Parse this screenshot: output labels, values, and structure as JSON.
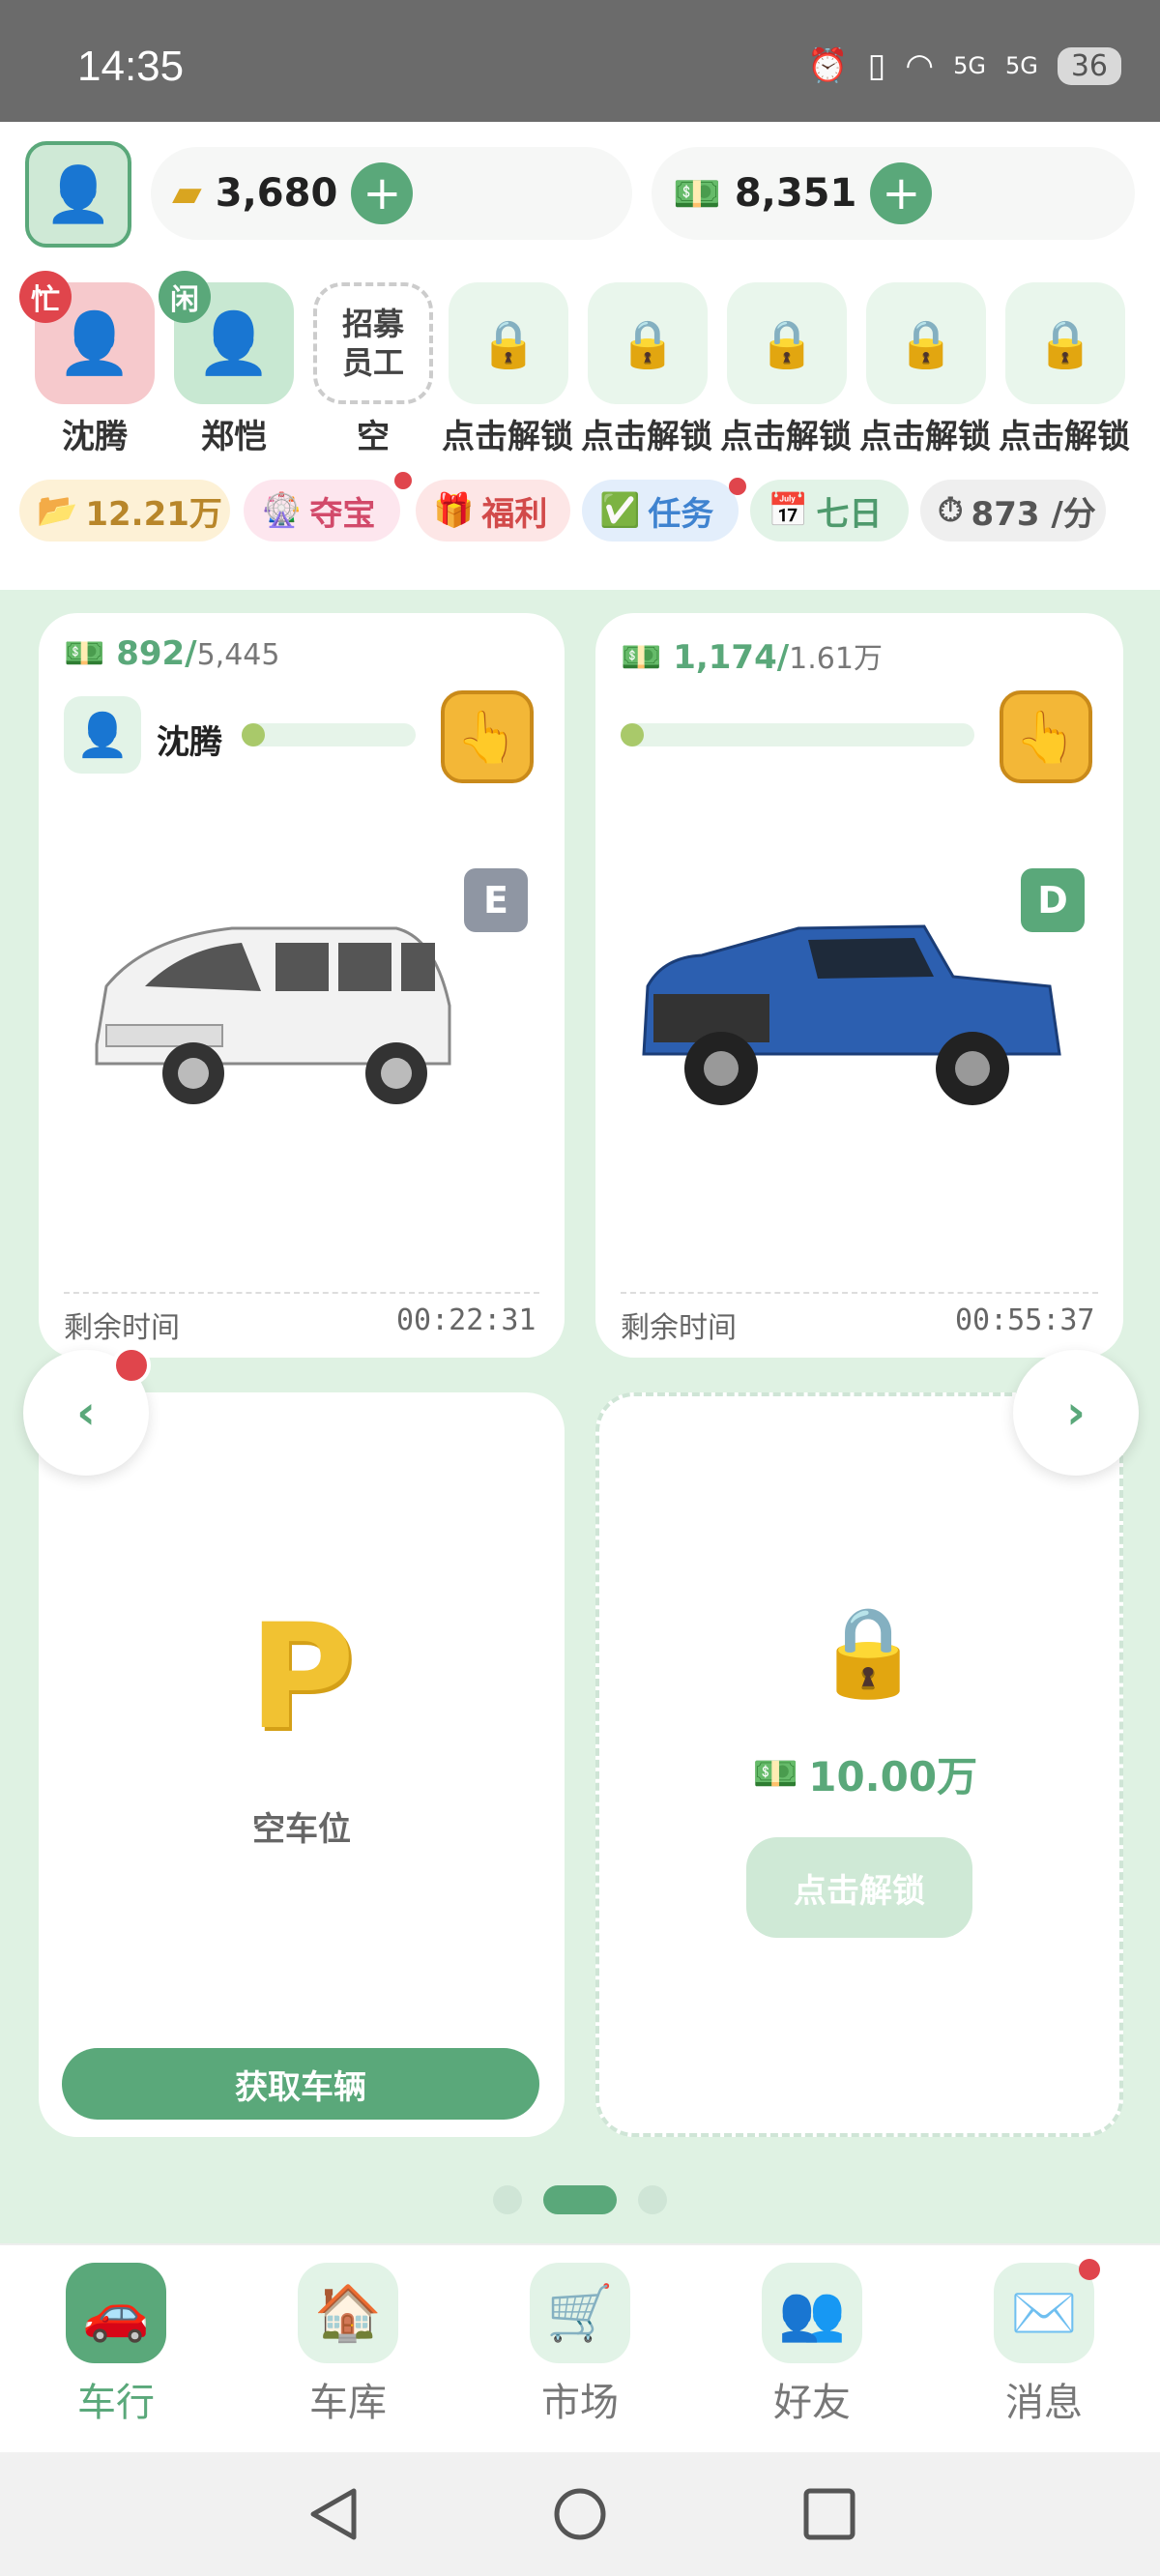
{
  "status": {
    "time": "14:35",
    "battery": "36",
    "signal": "5G"
  },
  "currencies": [
    {
      "icon": "gold-bars-icon",
      "value": "3,680"
    },
    {
      "icon": "cash-icon",
      "value": "8,351"
    }
  ],
  "staff": [
    {
      "name": "沈腾",
      "status": "忙",
      "type": "busy"
    },
    {
      "name": "郑恺",
      "status": "闲",
      "type": "idle"
    },
    {
      "name": "空",
      "recruit_line1": "招募",
      "recruit_line2": "员工",
      "type": "recruit"
    },
    {
      "name": "点击解锁",
      "type": "locked"
    },
    {
      "name": "点击解锁",
      "type": "locked"
    },
    {
      "name": "点击解锁",
      "type": "locked"
    },
    {
      "name": "点击解锁",
      "type": "locked"
    },
    {
      "name": "点击解锁",
      "type": "locked"
    }
  ],
  "chips": [
    {
      "label": "12.21万",
      "icon": "folder-icon"
    },
    {
      "label": "夺宝",
      "icon": "ferris-wheel-icon"
    },
    {
      "label": "福利",
      "icon": "gift-icon"
    },
    {
      "label": "任务",
      "icon": "checkbox-icon"
    },
    {
      "label": "七日",
      "icon": "calendar-icon"
    },
    {
      "label": "873 /分",
      "icon": "timer-icon"
    }
  ],
  "cards": [
    {
      "earned": "892/",
      "target": "5,445",
      "driver": "沈腾",
      "grade": "E",
      "remain_label": "剩余时间",
      "remain_time": "00:22:31",
      "progress": 0.08
    },
    {
      "earned": "1,174/",
      "target": "1.61万",
      "grade": "D",
      "remain_label": "剩余时间",
      "remain_time": "00:55:37",
      "progress": 0.05
    }
  ],
  "empty_slot": {
    "glyph": "P",
    "label": "空车位",
    "button": "获取车辆"
  },
  "locked_slot": {
    "price": "10.00万",
    "button": "点击解锁"
  },
  "pager": {
    "pages": 3,
    "current": 2
  },
  "bottom_nav": [
    {
      "label": "车行",
      "icon": "car-icon",
      "active": true
    },
    {
      "label": "车库",
      "icon": "house-icon"
    },
    {
      "label": "市场",
      "icon": "cart-icon"
    },
    {
      "label": "好友",
      "icon": "friends-icon"
    },
    {
      "label": "消息",
      "icon": "mail-icon"
    }
  ],
  "colors": {
    "accent": "#5aa87a",
    "background": "#dff2e3",
    "busy": "#e0454c",
    "gold": "#f3b737"
  }
}
